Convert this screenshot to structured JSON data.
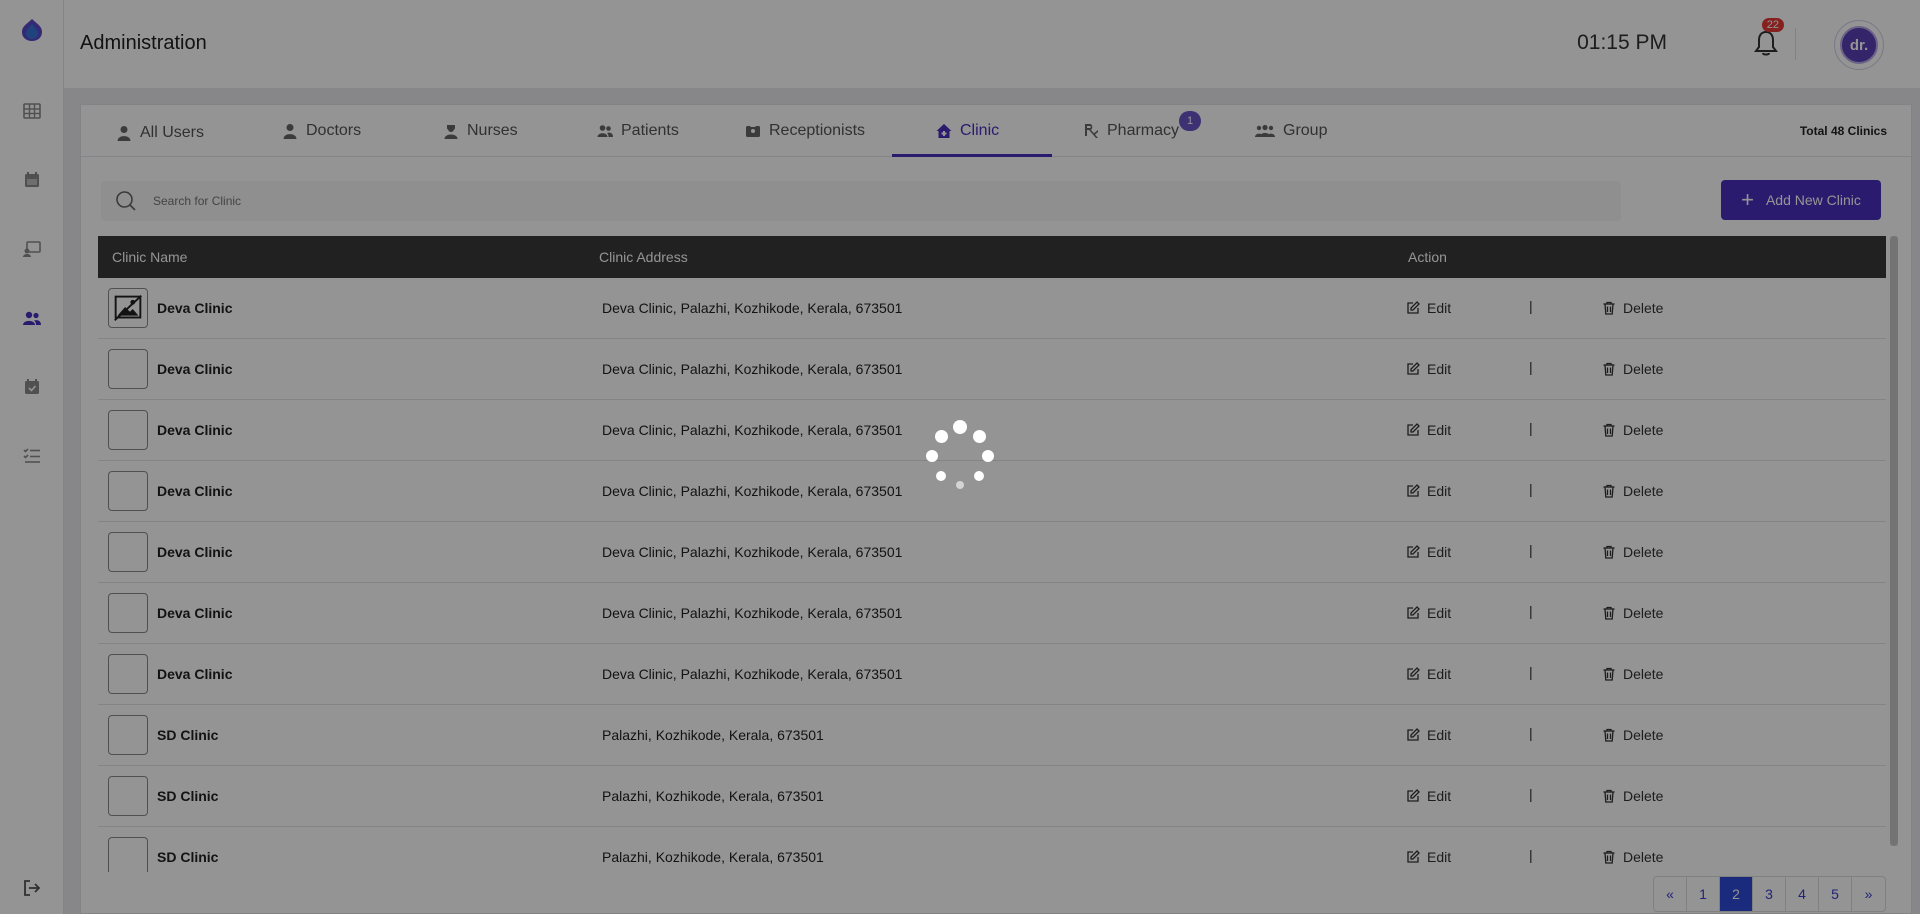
{
  "header": {
    "title": "Administration",
    "time": "01:15 PM",
    "notification_count": "22",
    "avatar_text": "dr."
  },
  "tabs": [
    {
      "label": "All Users",
      "icon": "user-icon"
    },
    {
      "label": "Doctors",
      "icon": "doctor-icon"
    },
    {
      "label": "Nurses",
      "icon": "nurse-icon"
    },
    {
      "label": "Patients",
      "icon": "users-icon"
    },
    {
      "label": "Receptionists",
      "icon": "id-badge-icon"
    },
    {
      "label": "Clinic",
      "icon": "clinic-icon",
      "active": true
    },
    {
      "label": "Pharmacy",
      "icon": "prescription-icon",
      "badge": "1"
    },
    {
      "label": "Group",
      "icon": "group-icon"
    }
  ],
  "total_label": "Total 48 Clinics",
  "search": {
    "placeholder": "Search for Clinic"
  },
  "add_button_label": "Add New Clinic",
  "table": {
    "headers": [
      "Clinic Name",
      "Clinic Address",
      "Action"
    ],
    "edit_label": "Edit",
    "separator": "|",
    "delete_label": "Delete",
    "rows": [
      {
        "name": "Deva Clinic",
        "address": "Deva Clinic, Palazhi, Kozhikode, Kerala, 673501",
        "broken_image": true
      },
      {
        "name": "Deva Clinic",
        "address": "Deva Clinic, Palazhi, Kozhikode, Kerala, 673501"
      },
      {
        "name": "Deva Clinic",
        "address": "Deva Clinic, Palazhi, Kozhikode, Kerala, 673501"
      },
      {
        "name": "Deva Clinic",
        "address": "Deva Clinic, Palazhi, Kozhikode, Kerala, 673501"
      },
      {
        "name": "Deva Clinic",
        "address": "Deva Clinic, Palazhi, Kozhikode, Kerala, 673501"
      },
      {
        "name": "Deva Clinic",
        "address": "Deva Clinic, Palazhi, Kozhikode, Kerala, 673501"
      },
      {
        "name": "Deva Clinic",
        "address": "Deva Clinic, Palazhi, Kozhikode, Kerala, 673501"
      },
      {
        "name": "SD Clinic",
        "address": "Palazhi, Kozhikode, Kerala, 673501"
      },
      {
        "name": "SD Clinic",
        "address": "Palazhi, Kozhikode, Kerala, 673501"
      },
      {
        "name": "SD Clinic",
        "address": "Palazhi, Kozhikode, Kerala, 673501"
      }
    ]
  },
  "pagination": {
    "prev": "«",
    "pages": [
      "1",
      "2",
      "3",
      "4",
      "5"
    ],
    "current": "2",
    "next": "»"
  },
  "colors": {
    "accent": "#4a2fc0",
    "page_active": "#2d4bd8",
    "badge": "#e53935",
    "table_header": "#3a3a3a"
  }
}
